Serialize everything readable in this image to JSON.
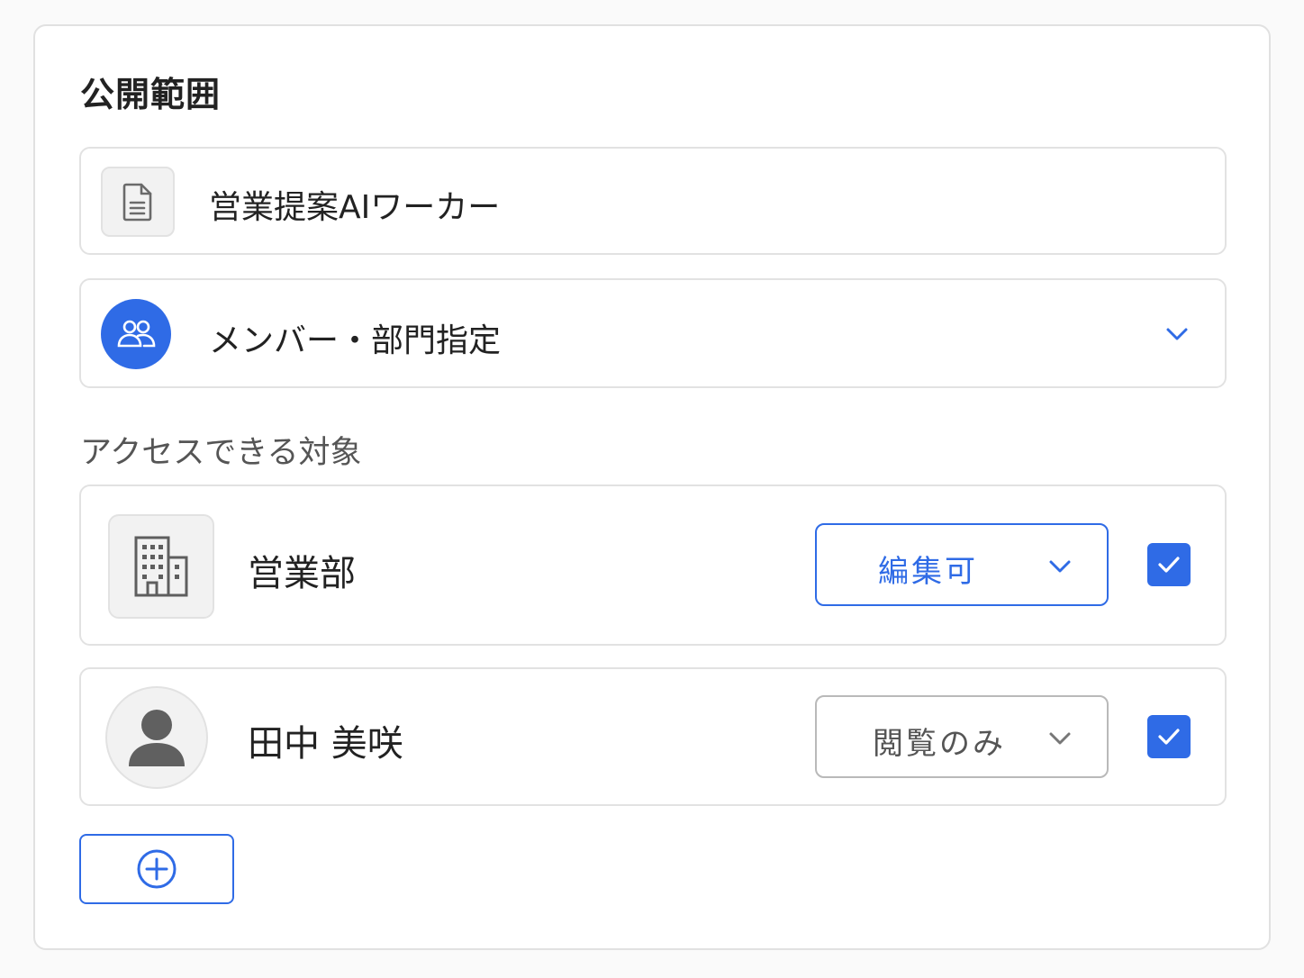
{
  "section": {
    "title": "公開範囲"
  },
  "worker": {
    "name": "営業提案AIワーカー",
    "icon": "document-icon"
  },
  "scope": {
    "label": "メンバー・部門指定",
    "icon": "users-group-icon",
    "expand_icon": "chevron-down-icon"
  },
  "targets": {
    "heading": "アクセスできる対象",
    "items": [
      {
        "name": "営業部",
        "icon": "building-icon",
        "permission": "編集可",
        "checked": true
      },
      {
        "name": "田中 美咲",
        "icon": "user-avatar-icon",
        "permission": "閲覧のみ",
        "checked": true
      }
    ]
  },
  "add_button": {
    "icon": "plus-circle-icon"
  },
  "colors": {
    "accent": "#2f6be6",
    "border": "#e2e2e2",
    "text": "#222222",
    "muted": "#555555"
  }
}
